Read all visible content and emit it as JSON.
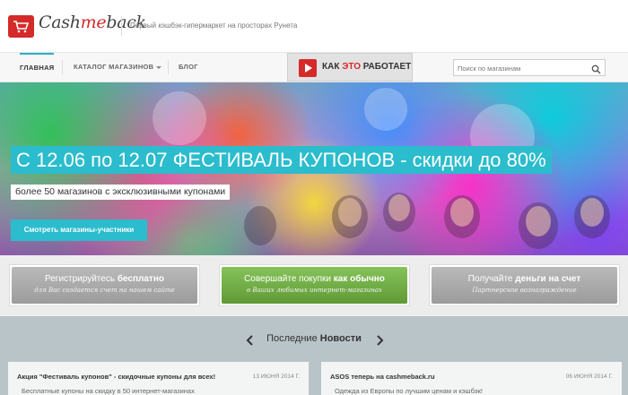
{
  "header": {
    "logo_prefix": "Cash",
    "logo_mid": "me",
    "logo_suffix": "back",
    "tagline": "Первый кэшбэк-гипермаркет на просторах Рунета"
  },
  "nav": {
    "items": [
      {
        "label": "ГЛАВНАЯ",
        "active": true
      },
      {
        "label": "КАТАЛОГ МАГАЗИНОВ",
        "has_dropdown": true
      },
      {
        "label": "БЛОГ"
      }
    ],
    "how_it_works": {
      "part1": "КАК ",
      "highlight": "ЭТО",
      "part2": " РАБОТАЕТ"
    },
    "search": {
      "placeholder": "Поиск по магазинам",
      "value": ""
    }
  },
  "hero": {
    "title": "С 12.06 по 12.07 ФЕСТИВАЛЬ КУПОНОВ - скидки до 80%",
    "subtitle": "более 50 магазинов с эксклюзивными купонами",
    "cta": "Смотреть магазины-участники"
  },
  "steps": [
    {
      "main_plain": "Регистрируйтесь ",
      "main_bold": "бесплатно",
      "sub": "для Вас создается счет на нашем сайте",
      "style": "grey"
    },
    {
      "main_plain": "Совершайте покупки ",
      "main_bold": "как обычно",
      "sub": "в Ваших любимых интернет-магазинах",
      "style": "green"
    },
    {
      "main_plain": "Получайте ",
      "main_bold": "деньги на счет",
      "sub": "Партнерское вознаграждение",
      "style": "grey"
    }
  ],
  "news": {
    "heading_plain": "Последние ",
    "heading_bold": "Новости",
    "items": [
      {
        "title": "Акция \"Фестиваль купонов\" - скидочные купоны для всех!",
        "date": "13 ИЮНЯ 2014 Г.",
        "text": "Бесплатные купоны на скидку в 50 интернет-магазинах"
      },
      {
        "title": "ASOS теперь на cashmeback.ru",
        "date": "06 ИЮНЯ 2014 Г.",
        "text": "Одежда из Европы по лучшим ценам и кэшбэк!"
      }
    ]
  },
  "colors": {
    "accent": "#2bbccd",
    "brand": "#d42a2a",
    "green_button": "#6fae45",
    "grey_button": "#a9a9a9"
  }
}
